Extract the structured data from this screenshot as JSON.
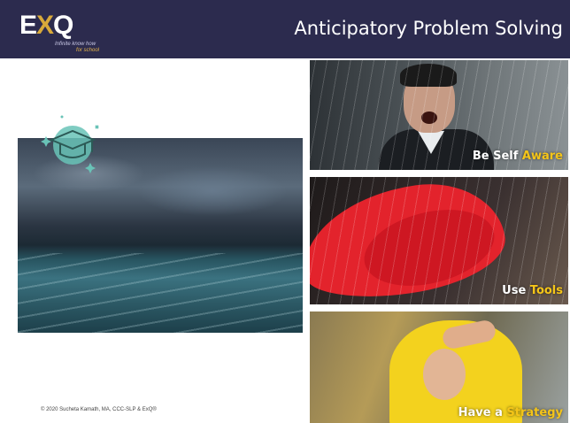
{
  "header": {
    "logo_mark_left": "E",
    "logo_mark_x": "X",
    "logo_mark_right": "Q",
    "logo_tagline": "Infinite know how",
    "logo_tagline2": "for school",
    "title": "Anticipatory Problem Solving"
  },
  "panels": [
    {
      "caption_plain": "Be Self ",
      "caption_highlight": "Aware"
    },
    {
      "caption_plain": "Use ",
      "caption_highlight": "Tools"
    },
    {
      "caption_plain": "Have a ",
      "caption_highlight": "Strategy"
    }
  ],
  "footer": {
    "copyright": "© 2020 Sucheta Kamath, MA, CCC-SLP & ExQ®"
  },
  "colors": {
    "header_bg": "#2c2b4e",
    "highlight": "#f5c518",
    "badge": "#69c3b7"
  },
  "icons": [
    "graduation-cap-icon",
    "sparkle-icon"
  ]
}
